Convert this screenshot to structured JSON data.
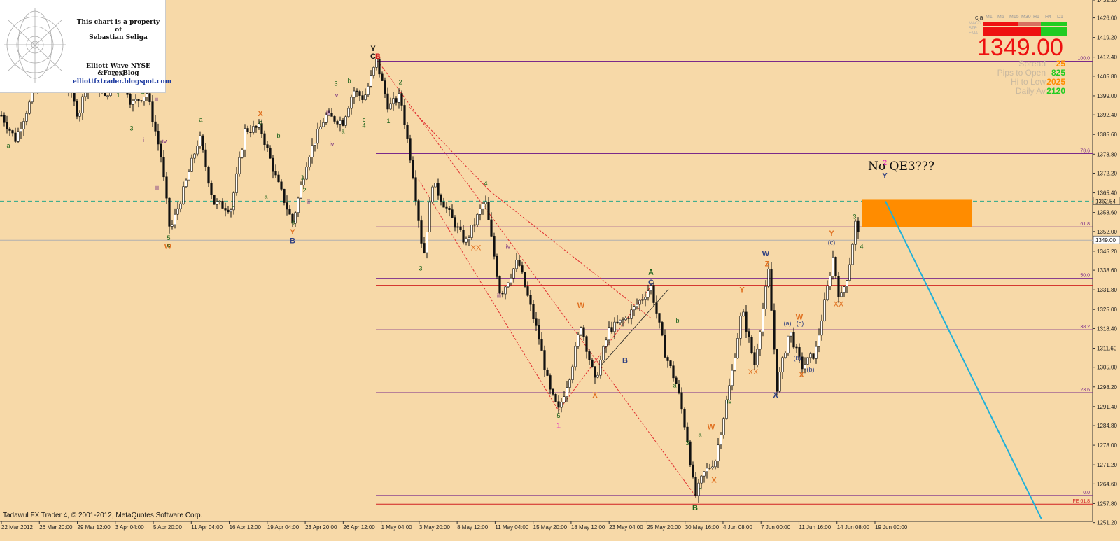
{
  "watermark": {
    "owner_line1": "This chart is a property of",
    "owner_line2": "Sebastian Seliga",
    "blog_title": "Elliott Wave NYSE &ForexBlog",
    "year": "2012",
    "url": "elliottfxtrader.blogspot.com"
  },
  "info_panel": {
    "symbol": "cja",
    "timeframes": [
      "M1",
      "M5",
      "M15",
      "M30",
      "H1",
      "H4",
      "D1"
    ],
    "signal_labels": [
      "MACD",
      "STR",
      "EMA"
    ],
    "last_price": "1349.00",
    "stats": [
      {
        "label": "Spread",
        "value": "25",
        "color": "#ff8c00"
      },
      {
        "label": "Pips to Open",
        "value": "825",
        "color": "#22cc22"
      },
      {
        "label": "Hi to Low",
        "value": "2025",
        "color": "#ff8c00"
      },
      {
        "label": "Daily Av",
        "value": "2120",
        "color": "#22cc22"
      }
    ]
  },
  "annotation": "No QE3???",
  "copyright": "Tadawul FX Trader 4, © 2001-2012, MetaQuotes Software Corp.",
  "colors": {
    "background": "#f7d9a8",
    "fib_line": "#7a2a8a",
    "red_line": "#d02020",
    "target_box": "#ff8c00",
    "projection": "#20b0d8",
    "channel": "#e03030"
  },
  "chart_data": {
    "type": "candlestick",
    "instrument": "cja",
    "last_price": 1349.0,
    "ylim": [
      1251.6,
      1432.2
    ],
    "y_ticks": [
      1432.2,
      1426.0,
      1419.2,
      1412.4,
      1405.8,
      1399.0,
      1392.4,
      1385.6,
      1378.8,
      1372.2,
      1365.4,
      1358.6,
      1352.0,
      1345.2,
      1338.6,
      1331.8,
      1325.0,
      1318.4,
      1311.6,
      1305.0,
      1298.2,
      1291.4,
      1284.8,
      1278.0,
      1271.2,
      1264.6,
      1257.8,
      1251.2
    ],
    "y_tick_labels": [
      "1432.20",
      "1426.00",
      "1419.20",
      "1412.40",
      "1405.80",
      "1399.00",
      "1392.40",
      "1385.60",
      "1378.80",
      "1372.20",
      "1365.40",
      "1358.60",
      "1352.00",
      "1345.20",
      "1338.60",
      "1331.80",
      "1325.00",
      "1318.40",
      "1311.60",
      "1305.00",
      "1298.20",
      "1291.40",
      "1284.80",
      "1278.00",
      "1271.20",
      "1264.60",
      "1257.80",
      "1251.20"
    ],
    "x_ticks": [
      "22 Mar 2012",
      "26 Mar 20:00",
      "29 Mar 12:00",
      "3 Apr 04:00",
      "5 Apr 20:00",
      "11 Apr 04:00",
      "16 Apr 12:00",
      "19 Apr 04:00",
      "23 Apr 20:00",
      "26 Apr 12:00",
      "1 May 04:00",
      "3 May 20:00",
      "8 May 12:00",
      "11 May 04:00",
      "15 May 20:00",
      "18 May 12:00",
      "23 May 04:00",
      "25 May 20:00",
      "30 May 16:00",
      "4 Jun 08:00",
      "7 Jun 00:00",
      "11 Jun 16:00",
      "14 Jun 08:00",
      "19 Jun 00:00"
    ],
    "fib_levels": [
      {
        "label": "100.0",
        "value": 1411.0
      },
      {
        "label": "78.6",
        "value": 1379.0
      },
      {
        "label": "61.8",
        "value": 1353.6
      },
      {
        "label": "50.0",
        "value": 1335.8
      },
      {
        "label": "38.2",
        "value": 1318.0
      },
      {
        "label": "23.6",
        "value": 1296.2
      },
      {
        "label": "0.0",
        "value": 1260.6
      },
      {
        "label": "FE 61.8",
        "value": 1257.6
      }
    ],
    "red_levels": [
      1333.4,
      1257.6
    ],
    "horizontal_lines": [
      {
        "label": "1362.54",
        "value": 1362.54,
        "style": "dashed"
      },
      {
        "label": "1349.00",
        "value": 1349.0,
        "style": "solid"
      }
    ],
    "target_zone": {
      "from": 1353.6,
      "to": 1363.0,
      "start": "19 Jun 00:00"
    },
    "path": [
      {
        "x": 0,
        "y": 1393
      },
      {
        "x": 22,
        "y": 1384
      },
      {
        "x": 48,
        "y": 1400
      },
      {
        "x": 72,
        "y": 1406
      },
      {
        "x": 95,
        "y": 1404
      },
      {
        "x": 112,
        "y": 1392
      },
      {
        "x": 128,
        "y": 1408
      },
      {
        "x": 150,
        "y": 1398
      },
      {
        "x": 170,
        "y": 1410
      },
      {
        "x": 188,
        "y": 1396
      },
      {
        "x": 210,
        "y": 1400
      },
      {
        "x": 230,
        "y": 1378
      },
      {
        "x": 243,
        "y": 1352
      },
      {
        "x": 262,
        "y": 1366
      },
      {
        "x": 285,
        "y": 1385
      },
      {
        "x": 305,
        "y": 1362
      },
      {
        "x": 330,
        "y": 1360
      },
      {
        "x": 350,
        "y": 1387
      },
      {
        "x": 372,
        "y": 1388
      },
      {
        "x": 395,
        "y": 1370
      },
      {
        "x": 418,
        "y": 1355
      },
      {
        "x": 440,
        "y": 1378
      },
      {
        "x": 465,
        "y": 1392
      },
      {
        "x": 490,
        "y": 1390
      },
      {
        "x": 505,
        "y": 1401
      },
      {
        "x": 520,
        "y": 1398
      },
      {
        "x": 538,
        "y": 1411
      },
      {
        "x": 555,
        "y": 1395
      },
      {
        "x": 572,
        "y": 1399
      },
      {
        "x": 590,
        "y": 1372
      },
      {
        "x": 605,
        "y": 1343
      },
      {
        "x": 618,
        "y": 1369
      },
      {
        "x": 640,
        "y": 1359
      },
      {
        "x": 665,
        "y": 1348
      },
      {
        "x": 693,
        "y": 1363
      },
      {
        "x": 715,
        "y": 1330
      },
      {
        "x": 740,
        "y": 1342
      },
      {
        "x": 770,
        "y": 1315
      },
      {
        "x": 785,
        "y": 1297
      },
      {
        "x": 798,
        "y": 1290
      },
      {
        "x": 815,
        "y": 1303
      },
      {
        "x": 830,
        "y": 1320
      },
      {
        "x": 850,
        "y": 1300
      },
      {
        "x": 870,
        "y": 1318
      },
      {
        "x": 895,
        "y": 1322
      },
      {
        "x": 930,
        "y": 1333
      },
      {
        "x": 950,
        "y": 1310
      },
      {
        "x": 968,
        "y": 1298
      },
      {
        "x": 982,
        "y": 1280
      },
      {
        "x": 993,
        "y": 1260
      },
      {
        "x": 1005,
        "y": 1268
      },
      {
        "x": 1022,
        "y": 1273
      },
      {
        "x": 1045,
        "y": 1302
      },
      {
        "x": 1060,
        "y": 1325
      },
      {
        "x": 1078,
        "y": 1306
      },
      {
        "x": 1098,
        "y": 1338
      },
      {
        "x": 1110,
        "y": 1298
      },
      {
        "x": 1128,
        "y": 1318
      },
      {
        "x": 1145,
        "y": 1305
      },
      {
        "x": 1165,
        "y": 1310
      },
      {
        "x": 1190,
        "y": 1343
      },
      {
        "x": 1200,
        "y": 1328
      },
      {
        "x": 1212,
        "y": 1338
      },
      {
        "x": 1222,
        "y": 1355
      },
      {
        "x": 1228,
        "y": 1349
      }
    ],
    "projection": [
      {
        "x": 1265,
        "y": 1362.5
      },
      {
        "x": 1488,
        "y": 1252.4
      }
    ],
    "wave_labels": [
      {
        "text": "Y",
        "x": 533,
        "y": 1414.5,
        "color": "#111111"
      },
      {
        "text": "C",
        "x": 533,
        "y": 1411.8,
        "color": "#111111"
      },
      {
        "text": "B",
        "x": 540,
        "y": 1411.8,
        "color": "#d02020"
      },
      {
        "text": "W",
        "x": 240,
        "y": 1346.0,
        "color": "#e07020"
      },
      {
        "text": "B",
        "x": 418,
        "y": 1348.0,
        "color": "#304080"
      },
      {
        "text": "1",
        "x": 798,
        "y": 1284.0,
        "color": "#e020c0"
      },
      {
        "text": "A",
        "x": 930,
        "y": 1337.0,
        "color": "#186018"
      },
      {
        "text": "W",
        "x": 1094,
        "y": 1343.5,
        "color": "#304080"
      },
      {
        "text": "B",
        "x": 993,
        "y": 1255.5,
        "color": "#186018"
      },
      {
        "text": "2",
        "x": 1264,
        "y": 1375.0,
        "color": "#e020c0"
      },
      {
        "text": "Y",
        "x": 1264,
        "y": 1370.5,
        "color": "#304080"
      },
      {
        "text": "X",
        "x": 1108,
        "y": 1294.5,
        "color": "#304080"
      },
      {
        "text": "4",
        "x": 694,
        "y": 1368.0,
        "color": "#186018"
      },
      {
        "text": "3",
        "x": 601,
        "y": 1338.5,
        "color": "#186018"
      },
      {
        "text": "5",
        "x": 798,
        "y": 1287.5,
        "color": "#186018"
      },
      {
        "text": "2",
        "x": 572,
        "y": 1403.0,
        "color": "#186018"
      },
      {
        "text": "1",
        "x": 555,
        "y": 1389.5,
        "color": "#186018"
      },
      {
        "text": "XX",
        "x": 1198,
        "y": 1326.0,
        "color": "#e07020"
      },
      {
        "text": "XX",
        "x": 1076,
        "y": 1302.5,
        "color": "#e07020"
      },
      {
        "text": "XX",
        "x": 680,
        "y": 1345.5,
        "color": "#e07020"
      },
      {
        "text": "W",
        "x": 830,
        "y": 1325.5,
        "color": "#e07020"
      },
      {
        "text": "X",
        "x": 850,
        "y": 1294.5,
        "color": "#e07020"
      },
      {
        "text": "X",
        "x": 372,
        "y": 1392.0,
        "color": "#e07020"
      },
      {
        "text": "Y",
        "x": 418,
        "y": 1351.0,
        "color": "#e07020"
      },
      {
        "text": "3",
        "x": 1221,
        "y": 1356.5,
        "color": "#186018"
      },
      {
        "text": "4",
        "x": 1231,
        "y": 1346.0,
        "color": "#186018"
      },
      {
        "text": "(c)",
        "x": 1188,
        "y": 1347.5,
        "color": "#304080"
      },
      {
        "text": "Y",
        "x": 1188,
        "y": 1350.5,
        "color": "#e07020"
      },
      {
        "text": "(a)",
        "x": 1125,
        "y": 1319.5,
        "color": "#304080"
      },
      {
        "text": "(b)",
        "x": 1139,
        "y": 1307.5,
        "color": "#304080"
      },
      {
        "text": "(c)",
        "x": 1143,
        "y": 1319.5,
        "color": "#304080"
      },
      {
        "text": "(b)",
        "x": 1158,
        "y": 1303.5,
        "color": "#304080"
      },
      {
        "text": "W",
        "x": 1142,
        "y": 1321.5,
        "color": "#e07020"
      },
      {
        "text": "X",
        "x": 1145,
        "y": 1301.5,
        "color": "#e07020"
      },
      {
        "text": "Y",
        "x": 1060,
        "y": 1331.0,
        "color": "#e07020"
      },
      {
        "text": "Z",
        "x": 1096,
        "y": 1340.0,
        "color": "#e07020"
      },
      {
        "text": "iv",
        "x": 726,
        "y": 1346.0,
        "color": "#6a1e7a"
      },
      {
        "text": "iii",
        "x": 713,
        "y": 1329.0,
        "color": "#6a1e7a"
      },
      {
        "text": "b",
        "x": 1000,
        "y": 1262.0,
        "color": "#186018"
      },
      {
        "text": "a",
        "x": 1000,
        "y": 1281.0,
        "color": "#186018"
      },
      {
        "text": "3",
        "x": 982,
        "y": 1278.0,
        "color": "#186018"
      },
      {
        "text": "iv",
        "x": 1042,
        "y": 1292.5,
        "color": "#186018"
      },
      {
        "text": "W",
        "x": 1016,
        "y": 1283.5,
        "color": "#e07020"
      },
      {
        "text": "X",
        "x": 1020,
        "y": 1265.0,
        "color": "#e07020"
      },
      {
        "text": "a",
        "x": 964,
        "y": 1298.0,
        "color": "#186018"
      },
      {
        "text": "b",
        "x": 968,
        "y": 1320.5,
        "color": "#186018"
      },
      {
        "text": "B",
        "x": 893,
        "y": 1306.5,
        "color": "#304080"
      },
      {
        "text": "C",
        "x": 930,
        "y": 1333.5,
        "color": "#304080"
      },
      {
        "text": "5",
        "x": 241,
        "y": 1349.0,
        "color": "#186018"
      },
      {
        "text": "c",
        "x": 241,
        "y": 1346.5,
        "color": "#186018"
      },
      {
        "text": "1",
        "x": 169,
        "y": 1398.5,
        "color": "#186018"
      },
      {
        "text": "3",
        "x": 188,
        "y": 1387.0,
        "color": "#186018"
      },
      {
        "text": "4",
        "x": 204,
        "y": 1399.5,
        "color": "#186018"
      },
      {
        "text": "iii",
        "x": 224,
        "y": 1366.5,
        "color": "#6a1e7a"
      },
      {
        "text": "iv",
        "x": 235,
        "y": 1382.5,
        "color": "#6a1e7a"
      },
      {
        "text": "ii",
        "x": 224,
        "y": 1397.0,
        "color": "#6a1e7a"
      },
      {
        "text": "i",
        "x": 205,
        "y": 1383.0,
        "color": "#6a1e7a"
      },
      {
        "text": "a",
        "x": 12,
        "y": 1381.0,
        "color": "#186018"
      },
      {
        "text": "a",
        "x": 287,
        "y": 1390.0,
        "color": "#186018"
      },
      {
        "text": "b",
        "x": 333,
        "y": 1360.5,
        "color": "#186018"
      },
      {
        "text": "c",
        "x": 372,
        "y": 1389.0,
        "color": "#186018"
      },
      {
        "text": "a",
        "x": 380,
        "y": 1363.5,
        "color": "#186018"
      },
      {
        "text": "b",
        "x": 398,
        "y": 1384.5,
        "color": "#186018"
      },
      {
        "text": "1",
        "x": 432,
        "y": 1370.0,
        "color": "#186018"
      },
      {
        "text": "2",
        "x": 435,
        "y": 1365.5,
        "color": "#186018"
      },
      {
        "text": "c",
        "x": 419,
        "y": 1354.5,
        "color": "#186018"
      },
      {
        "text": "ii",
        "x": 441,
        "y": 1361.5,
        "color": "#6a1e7a"
      },
      {
        "text": "iii",
        "x": 469,
        "y": 1392.5,
        "color": "#6a1e7a"
      },
      {
        "text": "iv",
        "x": 474,
        "y": 1381.5,
        "color": "#6a1e7a"
      },
      {
        "text": "3",
        "x": 480,
        "y": 1402.5,
        "color": "#186018"
      },
      {
        "text": "b",
        "x": 499,
        "y": 1403.5,
        "color": "#186018"
      },
      {
        "text": "a",
        "x": 490,
        "y": 1386.0,
        "color": "#186018"
      },
      {
        "text": "4",
        "x": 520,
        "y": 1388.0,
        "color": "#186018"
      },
      {
        "text": "c",
        "x": 520,
        "y": 1390.0,
        "color": "#186018"
      },
      {
        "text": "v",
        "x": 481,
        "y": 1398.5,
        "color": "#6a1e7a"
      }
    ]
  }
}
